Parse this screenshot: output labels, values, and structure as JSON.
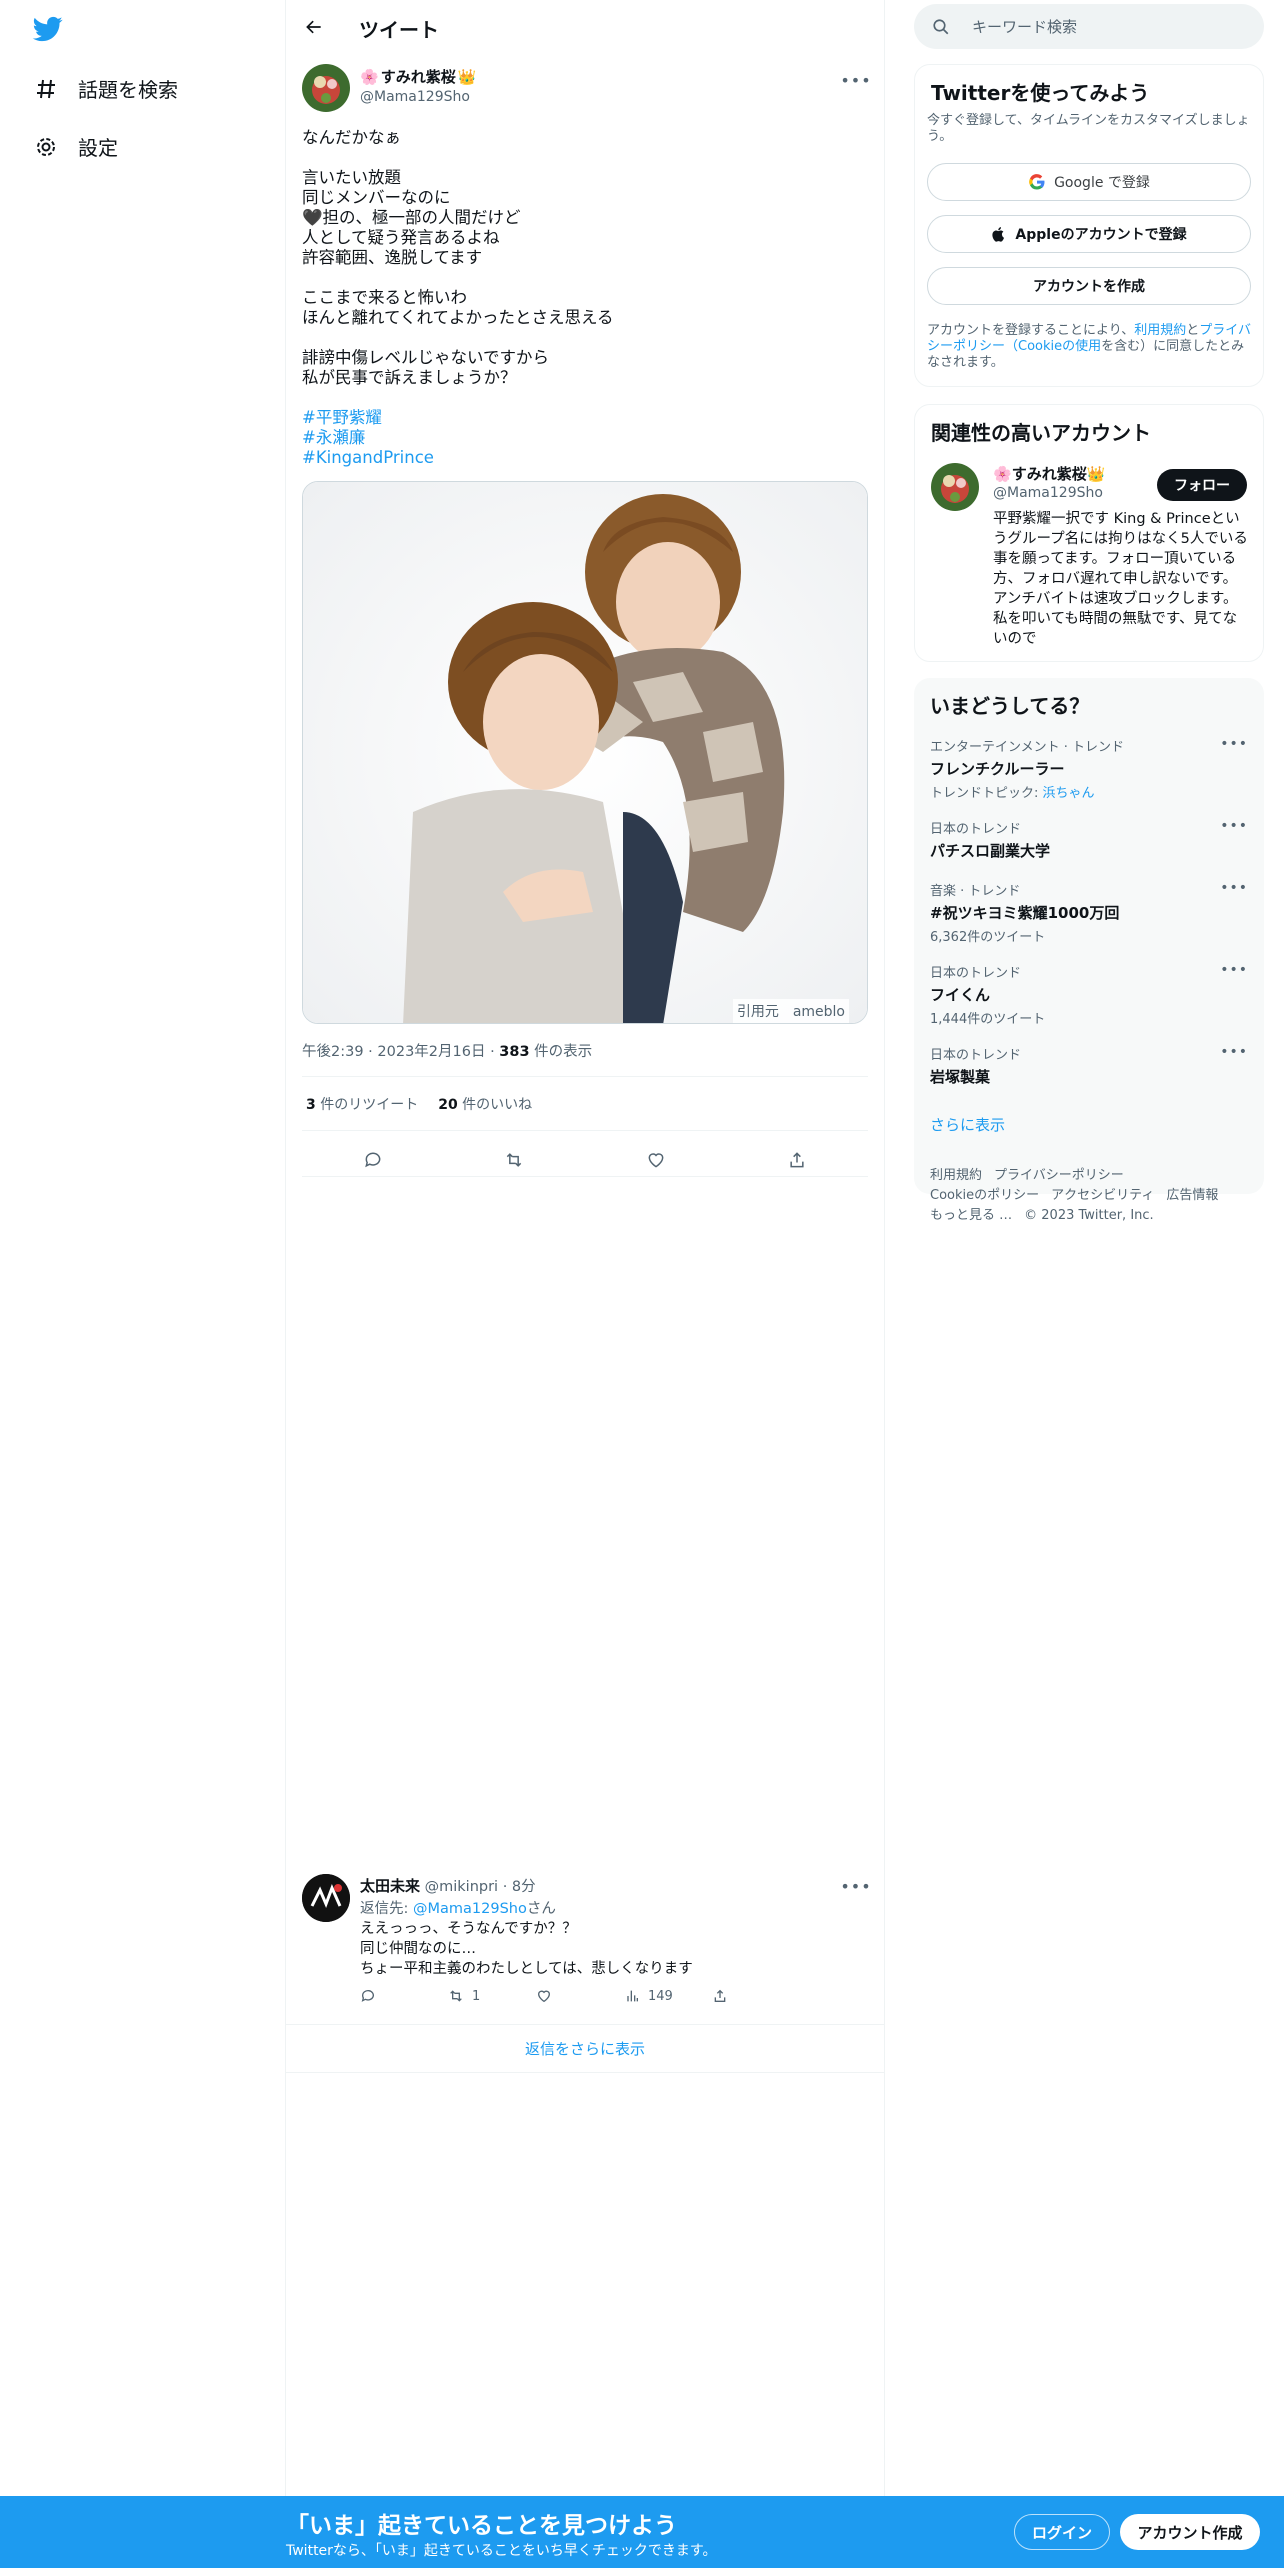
{
  "nav": {
    "logo_icon": "twitter-bird-icon",
    "explore_label": "話題を検索",
    "settings_label": "設定"
  },
  "header": {
    "title": "ツイート"
  },
  "tweet": {
    "name": "すみれ紫桜",
    "handle": "@Mama129Sho",
    "text": "なんだかなぁ\n\n言いたい放題\n同じメンバーなのに\n🖤担の、極一部の人間だけど\n人として疑う発言あるよね\n許容範囲、逸脱してます\n\nここまで来ると怖いわ\nほんと離れてくれてよかったとさえ思える\n\n誹謗中傷レベルじゃないですから\n私が民事で訴えましょうか？",
    "hashtags": [
      "#平野紫耀",
      "#永瀬廉",
      "#KingandPrince"
    ],
    "media_credit": "引用元　ameblo",
    "time": "午後2:39 · 2023年2月16日 · ",
    "views": "383",
    "views_label": " 件の表示",
    "retweets": "3",
    "retweets_label": " 件のリツイート",
    "likes": "20",
    "likes_label": " 件のいいね"
  },
  "reply": {
    "name": "太田未来",
    "handle": "@mikinpri",
    "time": " · 8分",
    "reply_to_label": "返信先: ",
    "reply_to_handle": "@Mama129Sho",
    "reply_to_suffix": "さん",
    "text": "ええっっっ、そうなんですか？？\n同じ仲間なのに…\nちょー平和主義のわたしとしては、悲しくなります",
    "retweets": "1",
    "views": "149"
  },
  "show_more_replies": "返信をさらに表示",
  "search": {
    "placeholder": "キーワード検索"
  },
  "signup_card": {
    "title": "Twitterを使ってみよう",
    "desc": "今すぐ登録して、タイムラインをカスタマイズしましょう。",
    "google_label": "Google で登録",
    "apple_label": "Appleのアカウントで登録",
    "create_label": "アカウントを作成",
    "legal_prefix": "アカウントを登録することにより、",
    "legal_terms": "利用規約",
    "legal_and": "と",
    "legal_privacy": "プライバシーポリシー（Cookieの使用",
    "legal_suffix": "を含む）に同意したとみなされます。"
  },
  "related": {
    "title": "関連性の高いアカウント",
    "name": "すみれ紫桜",
    "handle": "@Mama129Sho",
    "follow_label": "フォロー",
    "bio": "平野紫耀一択です King & Princeというグループ名には拘りはなく5人でいる事を願ってます。フォロー頂いている方、フォロバ遅れて申し訳ないです。アンチバイトは速攻ブロックします。私を叩いても時間の無駄です、見てないので"
  },
  "trends": {
    "title": "いまどうしてる？",
    "items": [
      {
        "category": "エンターテインメント · トレンド",
        "name": "フレンチクルーラー",
        "sub_prefix": "トレンドトピック: ",
        "sub_link": "浜ちゃん"
      },
      {
        "category": "日本のトレンド",
        "name": "パチスロ副業大学",
        "sub_prefix": "",
        "sub_link": ""
      },
      {
        "category": "音楽 · トレンド",
        "name": "#祝ツキヨミ紫耀1000万回",
        "sub_prefix": "6,362件のツイート",
        "sub_link": ""
      },
      {
        "category": "日本のトレンド",
        "name": "フイくん",
        "sub_prefix": "1,444件のツイート",
        "sub_link": ""
      },
      {
        "category": "日本のトレンド",
        "name": "岩塚製菓",
        "sub_prefix": "",
        "sub_link": ""
      }
    ],
    "show_more": "さらに表示"
  },
  "footer": {
    "terms": "利用規約",
    "privacy": "プライバシーポリシー",
    "cookies": "Cookieのポリシー",
    "accessibility": "アクセシビリティ",
    "ads": "広告情報",
    "more": "もっと見る …",
    "copyright": "© 2023 Twitter, Inc."
  },
  "banner": {
    "title": "「いま」起きていることを見つけよう",
    "sub": "Twitterなら、「いま」起きていることをいち早くチェックできます。",
    "login_label": "ログイン",
    "signup_label": "アカウント作成"
  },
  "colors": {
    "accent": "#1d9bf0",
    "text": "#0f1419",
    "muted": "#536471"
  }
}
